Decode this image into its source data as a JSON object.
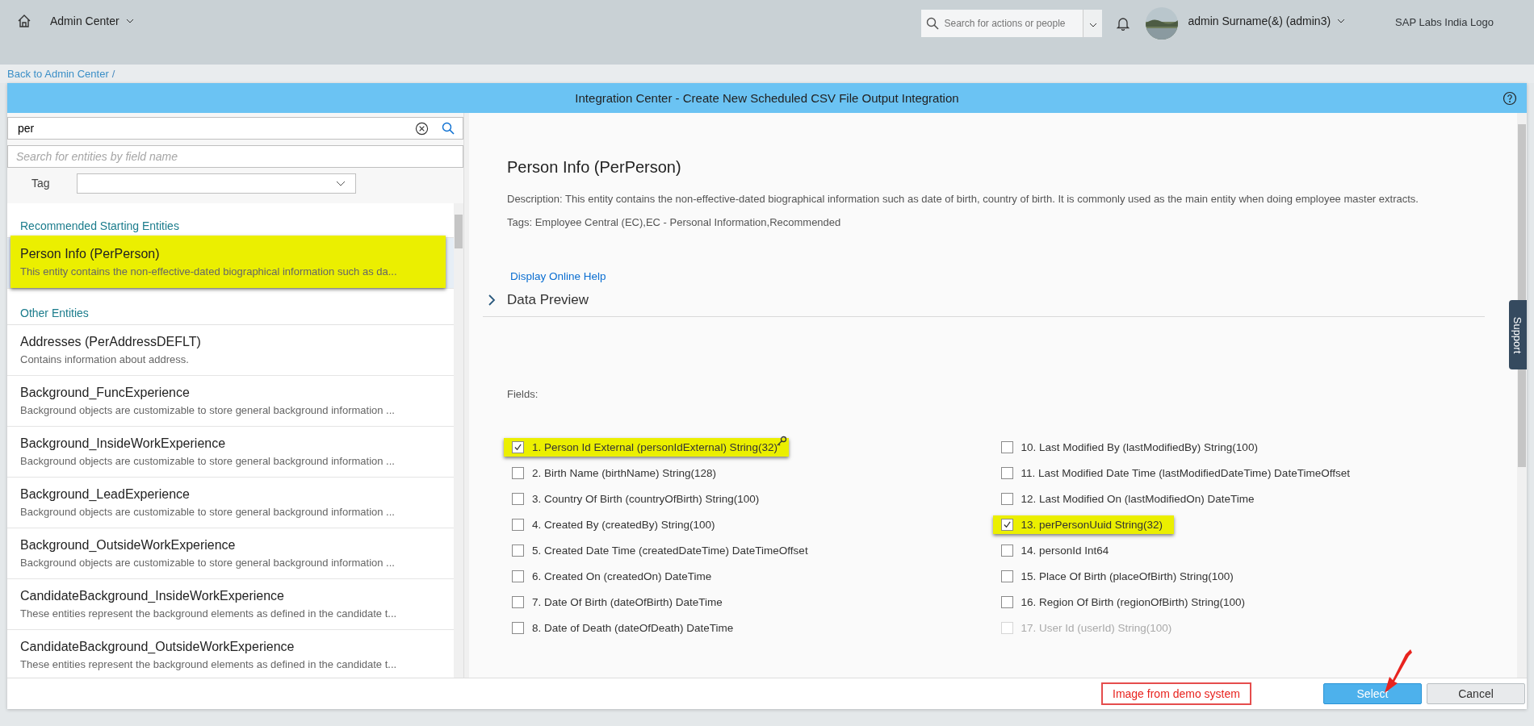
{
  "shell": {
    "title": "Admin Center",
    "search_placeholder": "Search for actions or people",
    "user": "admin Surname(&) (admin3)",
    "logo": "SAP Labs India Logo"
  },
  "breadcrumb": {
    "link": "Back to Admin Center",
    "separator": "/"
  },
  "dialog": {
    "title": "Integration Center - Create New Scheduled CSV File Output Integration"
  },
  "left": {
    "search_value": "per",
    "field_placeholder": "Search for entities by field name",
    "tag_label": "Tag",
    "groups": [
      {
        "title": "Recommended Starting Entities",
        "entities": [
          {
            "name": "Person Info (PerPerson)",
            "description": "This entity contains the non-effective-dated biographical information such as da...",
            "selected": true,
            "highlighted": true
          }
        ]
      },
      {
        "title": "Other Entities",
        "entities": [
          {
            "name": "Addresses (PerAddressDEFLT)",
            "description": "Contains information about address.",
            "selected": false,
            "highlighted": false
          },
          {
            "name": "Background_FuncExperience",
            "description": "Background objects are customizable to store general background information ...",
            "selected": false,
            "highlighted": false
          },
          {
            "name": "Background_InsideWorkExperience",
            "description": "Background objects are customizable to store general background information ...",
            "selected": false,
            "highlighted": false
          },
          {
            "name": "Background_LeadExperience",
            "description": "Background objects are customizable to store general background information ...",
            "selected": false,
            "highlighted": false
          },
          {
            "name": "Background_OutsideWorkExperience",
            "description": "Background objects are customizable to store general background information ...",
            "selected": false,
            "highlighted": false
          },
          {
            "name": "CandidateBackground_InsideWorkExperience",
            "description": "These entities represent the background elements as defined in the candidate t...",
            "selected": false,
            "highlighted": false
          },
          {
            "name": "CandidateBackground_OutsideWorkExperience",
            "description": "These entities represent the background elements as defined in the candidate t...",
            "selected": false,
            "highlighted": false
          }
        ]
      }
    ]
  },
  "right": {
    "title": "Person Info (PerPerson)",
    "description": "Description: This entity contains the non-effective-dated biographical information such as date of birth, country of birth. It is commonly used as the main entity when doing employee master extracts.",
    "tags": "Tags: Employee Central (EC),EC - Personal Information,Recommended",
    "help_link": "Display Online Help",
    "section": {
      "title": "Data Preview",
      "expanded": false
    },
    "fields_label": "Fields:",
    "field_columns": [
      [
        {
          "label": "1. Person Id External (personIdExternal) String(32)",
          "checked": true,
          "highlighted": true,
          "disabled": false,
          "key": true
        },
        {
          "label": "2. Birth Name (birthName) String(128)",
          "checked": false,
          "highlighted": false,
          "disabled": false,
          "key": false
        },
        {
          "label": "3. Country Of Birth (countryOfBirth) String(100)",
          "checked": false,
          "highlighted": false,
          "disabled": false,
          "key": false
        },
        {
          "label": "4. Created By (createdBy) String(100)",
          "checked": false,
          "highlighted": false,
          "disabled": false,
          "key": false
        },
        {
          "label": "5. Created Date Time (createdDateTime) DateTimeOffset",
          "checked": false,
          "highlighted": false,
          "disabled": false,
          "key": false
        },
        {
          "label": "6. Created On (createdOn) DateTime",
          "checked": false,
          "highlighted": false,
          "disabled": false,
          "key": false
        },
        {
          "label": "7. Date Of Birth (dateOfBirth) DateTime",
          "checked": false,
          "highlighted": false,
          "disabled": false,
          "key": false
        },
        {
          "label": "8. Date of Death (dateOfDeath) DateTime",
          "checked": false,
          "highlighted": false,
          "disabled": false,
          "key": false
        }
      ],
      [
        {
          "label": "10. Last Modified By (lastModifiedBy) String(100)",
          "checked": false,
          "highlighted": false,
          "disabled": false,
          "key": false
        },
        {
          "label": "11. Last Modified Date Time (lastModifiedDateTime) DateTimeOffset",
          "checked": false,
          "highlighted": false,
          "disabled": false,
          "key": false
        },
        {
          "label": "12. Last Modified On (lastModifiedOn) DateTime",
          "checked": false,
          "highlighted": false,
          "disabled": false,
          "key": false
        },
        {
          "label": "13. perPersonUuid String(32)",
          "checked": true,
          "highlighted": true,
          "disabled": false,
          "key": false
        },
        {
          "label": "14. personId Int64",
          "checked": false,
          "highlighted": false,
          "disabled": false,
          "key": false
        },
        {
          "label": "15. Place Of Birth (placeOfBirth) String(100)",
          "checked": false,
          "highlighted": false,
          "disabled": false,
          "key": false
        },
        {
          "label": "16. Region Of Birth (regionOfBirth) String(100)",
          "checked": false,
          "highlighted": false,
          "disabled": false,
          "key": false
        },
        {
          "label": "17. User Id (userId) String(100)",
          "checked": false,
          "highlighted": false,
          "disabled": true,
          "key": false
        }
      ]
    ]
  },
  "support": "Support",
  "buttons": [
    {
      "label": "Select",
      "kind": "primary"
    },
    {
      "label": "Cancel",
      "kind": "secondary"
    }
  ],
  "annotation": "Image from demo system"
}
